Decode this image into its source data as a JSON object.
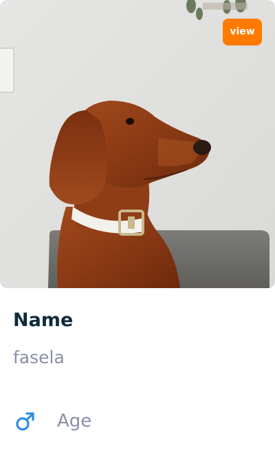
{
  "card": {
    "image": {
      "subject": "dog-photo"
    },
    "view_button": {
      "label": "view",
      "color": "#ff7a00"
    },
    "name_heading": "Name",
    "name_value": "fasela",
    "gender": {
      "icon": "male-icon",
      "color": "#2d8ee0"
    },
    "age_label": "Age"
  }
}
